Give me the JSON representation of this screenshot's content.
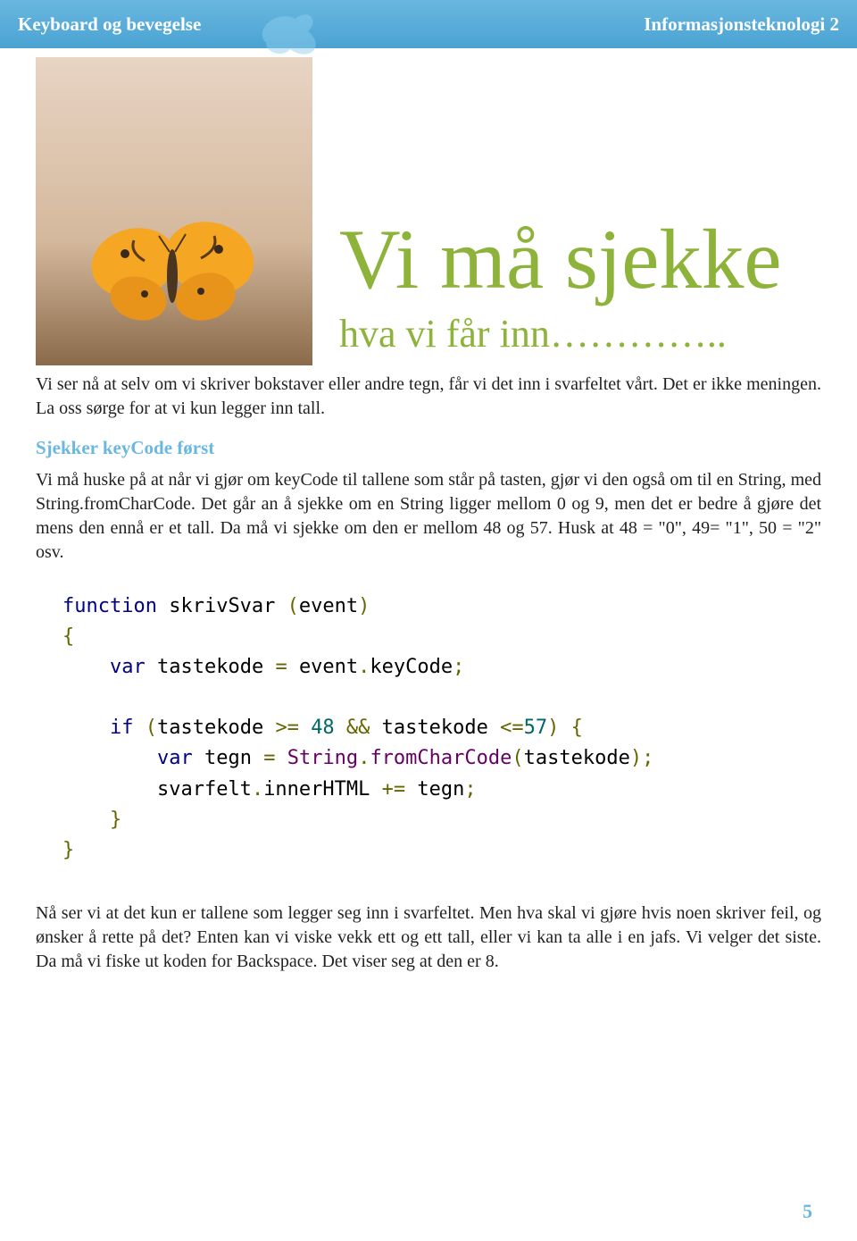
{
  "header": {
    "left": "Keyboard og bevegelse",
    "right": "Informasjonsteknologi 2"
  },
  "title": "Vi må sjekke",
  "subtitle": "hva vi får inn…………..",
  "intro": "Vi ser nå at selv om vi skriver bokstaver eller andre tegn, får vi det inn i svarfeltet vårt. Det er ikke meningen. La oss sørge for at vi kun legger inn tall.",
  "section_heading": "Sjekker keyCode først",
  "para2": "Vi må huske på at når vi gjør om keyCode til tallene som står på tasten, gjør vi den også om til en String, med String.fromCharCode. Det går an å sjekke om en String ligger mellom 0 og 9, men det er bedre å gjøre det mens den ennå er et tall. Da må vi sjekke om den er mellom 48 og 57. Husk at 48 = \"0\", 49= \"1\", 50 = \"2\" osv.",
  "code": {
    "l1_kw": "function",
    "l1_fn": " skrivSvar ",
    "l1_p1": "(",
    "l1_arg": "event",
    "l1_p2": ")",
    "l2": "{",
    "l3_kw": "var",
    "l3_id": " tastekode ",
    "l3_eq": "= ",
    "l3_ev": "event",
    "l3_dot": ".",
    "l3_prop": "keyCode",
    "l3_semi": ";",
    "l5_kw": "if",
    "l5_p1": " (",
    "l5_id1": "tastekode ",
    "l5_op1": ">= ",
    "l5_n1": "48",
    "l5_and": " && ",
    "l5_id2": "tastekode ",
    "l5_op2": "<=",
    "l5_n2": "57",
    "l5_p2": ") {",
    "l6_kw": "var",
    "l6_id": " tegn ",
    "l6_eq": "= ",
    "l6_str": "String",
    "l6_dot": ".",
    "l6_meth": "fromCharCode",
    "l6_p1": "(",
    "l6_arg": "tastekode",
    "l6_p2": ");",
    "l7_id": "svarfelt",
    "l7_dot": ".",
    "l7_prop": "innerHTML ",
    "l7_op": "+= ",
    "l7_rhs": "tegn",
    "l7_semi": ";",
    "l8": "}",
    "l9": "}"
  },
  "para3": "Nå ser vi at det kun er tallene som legger seg inn i svarfeltet. Men hva skal vi gjøre hvis noen skriver feil, og ønsker å rette på det? Enten kan vi viske vekk ett og ett tall, eller vi kan ta alle i en jafs. Vi velger det siste. Da må vi fiske ut koden for Backspace. Det viser seg at den er 8.",
  "page_number": "5"
}
